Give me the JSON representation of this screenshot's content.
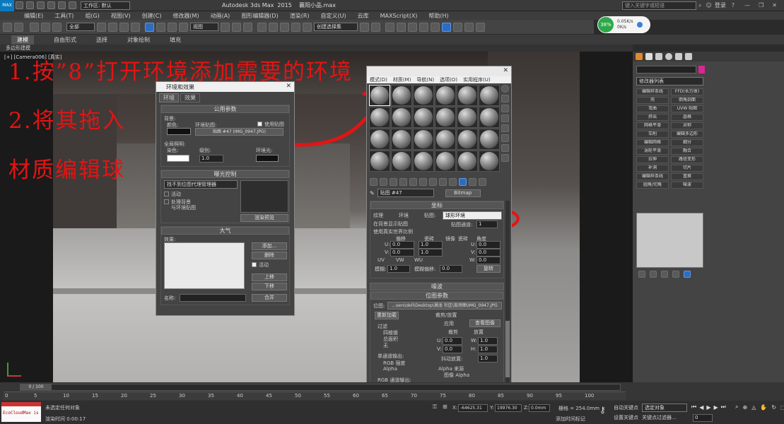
{
  "window": {
    "title": "Autodesk 3ds Max  2015    襄阳小品.max",
    "workspace": "工作区: 默认",
    "search_placeholder": "键入关键字或短语",
    "login": "登录"
  },
  "menu": [
    "编辑(E)",
    "工具(T)",
    "组(G)",
    "视图(V)",
    "创建(C)",
    "修改器(M)",
    "动画(A)",
    "图形编辑器(D)",
    "渲染(R)",
    "自定义(U)",
    "云库",
    "MAXScript(X)",
    "帮助(H)"
  ],
  "toolbar": {
    "selection_filter": "全部",
    "view": "视图",
    "selection_set": "创建选择集"
  },
  "ribbon": {
    "tabs": [
      "建模",
      "自由形式",
      "选择",
      "对象绘制",
      "填充"
    ],
    "sub": "多边形建模"
  },
  "network": {
    "percent": "38%",
    "up": "0.05K/s",
    "down": "0K/s"
  },
  "viewport": {
    "label": "[+] [Camera006] [真实]",
    "annotations": [
      "1.按”8”打开环境添加需要的环境",
      "2.将其拖入",
      "材质编辑球"
    ]
  },
  "env_dialog": {
    "title": "环境和效果",
    "tabs": [
      "环境",
      "效果"
    ],
    "common": "公用参数",
    "background": "背景:",
    "color": "颜色:",
    "env_map": "环境贴图:",
    "use_map": "使用贴图",
    "map_button": "贴图 #47 (IMG_0947.JPG)",
    "global_light": "全局照明:",
    "tint": "染色:",
    "level": "级别:",
    "level_value": "1.0",
    "ambient": "环境光:",
    "exposure": "曝光控制",
    "exposure_option": "找不到位图代理管理器",
    "active": "活动",
    "process_bg": "处理背景",
    "and_env": "与环境贴图",
    "render_preview": "渲染预览",
    "atmosphere": "大气",
    "effects": "效果:",
    "add": "添加...",
    "delete": "删除",
    "active2": "活动",
    "up": "上移",
    "down": "下移",
    "name": "名称:",
    "merge": "合并"
  },
  "mat_editor": {
    "title": "",
    "menu": [
      "模式(D)",
      "材质(M)",
      "导航(N)",
      "选项(O)",
      "实用程序(U)"
    ],
    "map_name": "贴图 #47",
    "map_type": "Bitmap",
    "coordinates": "坐标",
    "texture": "纹理",
    "environ": "环境",
    "mapping": "贴图:",
    "mapping_value": "球形环境",
    "show_bg": "在背景显示贴图",
    "real_world": "使用真实世界比例",
    "map_channel": "贴图通道:",
    "map_channel_value": "1",
    "offset": "偏移",
    "tiling": "瓷砖",
    "mirror": "镜像",
    "tile": "瓷砖",
    "angle": "角度",
    "u": "U:",
    "v": "V:",
    "w": "W:",
    "u_offset": "0.0",
    "u_tile": "1.0",
    "v_offset": "0.0",
    "v_tile": "1.0",
    "u_angle": "0.0",
    "v_angle": "0.0",
    "w_angle": "0.0",
    "uv": "UV",
    "vw": "VW",
    "wu": "WU",
    "blur": "模糊:",
    "blur_value": "1.0",
    "blur_offset": "模糊偏移:",
    "blur_offset_value": "0.0",
    "rotate": "旋转",
    "noise": "噪波",
    "bitmap_params": "位图参数",
    "bitmap_label": "位图:",
    "bitmap_path": "...sers\\dell\\Desktop\\湘龙 社区\\现场图\\IMG_0947.JPG",
    "reload": "重新加载",
    "crop": "裁剪/放置",
    "apply": "应用",
    "view_image": "查看图像",
    "crop_opt": "裁剪",
    "place": "放置",
    "filter": "过滤",
    "quad": "四棱锥",
    "sum": "总面积",
    "none": "无",
    "u_crop": "0.0",
    "w_crop": "1.0",
    "v_crop": "0.0",
    "h_crop": "1.0",
    "jitter": "抖动放置:",
    "jitter_value": "1.0",
    "single_out": "单通道输出:",
    "rgb": "RGB 强度",
    "alpha": "Alpha",
    "alpha_source": "Alpha 来源",
    "img_alpha": "图像 Alpha",
    "rgb_out": "RGB 通道输出:"
  },
  "command_panel": {
    "modifier_list": "修改器列表",
    "buttons": [
      "编辑样条线",
      "FFD(长方体)",
      "壳",
      "倒角剖面",
      "弯曲",
      "UVW 贴图",
      "挤出",
      "晶格",
      "网格平滑",
      "对称",
      "车削",
      "编辑多边形",
      "编辑网格",
      "细分",
      "涡轮平滑",
      "融合",
      "拉伸",
      "路径变形",
      "补洞",
      "切片",
      "编辑样条线",
      "置换",
      "圆角/切角",
      "噪波"
    ]
  },
  "timeline": {
    "frame": "0 / 100",
    "ticks": [
      "0",
      "5",
      "10",
      "15",
      "20",
      "25",
      "30",
      "35",
      "40",
      "45",
      "50",
      "55",
      "60",
      "65",
      "70",
      "75",
      "80",
      "85",
      "90",
      "95",
      "100"
    ]
  },
  "status": {
    "logo": "EcoCloudMax is",
    "no_select": "未选定任何对象",
    "render_time": "渲染时间  0:00:17",
    "x": "-64625.31",
    "y": "19976.30",
    "z": "0.0mm",
    "grid": "栅格 = 254.0mm",
    "autokey": "自动关键点",
    "set_key": "设置关键点",
    "select_obj": "选定对象",
    "key_filter": "关键点过滤器...",
    "add_time_tag": "添加时间标记",
    "frame_value": "0"
  }
}
